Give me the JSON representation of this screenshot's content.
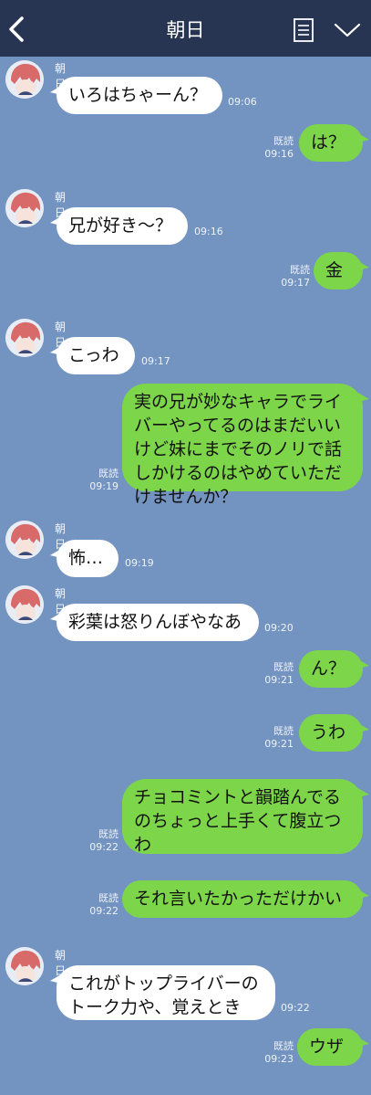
{
  "header": {
    "title": "朝日"
  },
  "sender_name": "朝日",
  "read_label": "既読",
  "messages": [
    {
      "text": "いろはちゃーん？",
      "time": "09:06"
    },
    {
      "text": "は？",
      "time": "09:16"
    },
    {
      "text": "兄が好き～？",
      "time": "09:16"
    },
    {
      "text": "金",
      "time": "09:17"
    },
    {
      "text": "こっわ",
      "time": "09:17"
    },
    {
      "text": "実の兄が妙なキャラでライバーやってるのはまだいいけど妹にまでそのノリで話しかけるのはやめていただけませんか？",
      "time": "09:19"
    },
    {
      "text": "怖…",
      "time": "09:19"
    },
    {
      "text": "彩葉は怒りんぼやなあ",
      "time": "09:20"
    },
    {
      "text": "ん？",
      "time": "09:21"
    },
    {
      "text": "うわ",
      "time": "09:21"
    },
    {
      "text": "チョコミントと韻踏んでるのちょっと上手くて腹立つわ",
      "time": "09:22"
    },
    {
      "text": "それ言いたかっただけかい",
      "time": "09:22"
    },
    {
      "text": "これがトップライバーのトーク力や、覚えとき",
      "time": "09:22"
    },
    {
      "text": "ウザ",
      "time": "09:23"
    }
  ]
}
